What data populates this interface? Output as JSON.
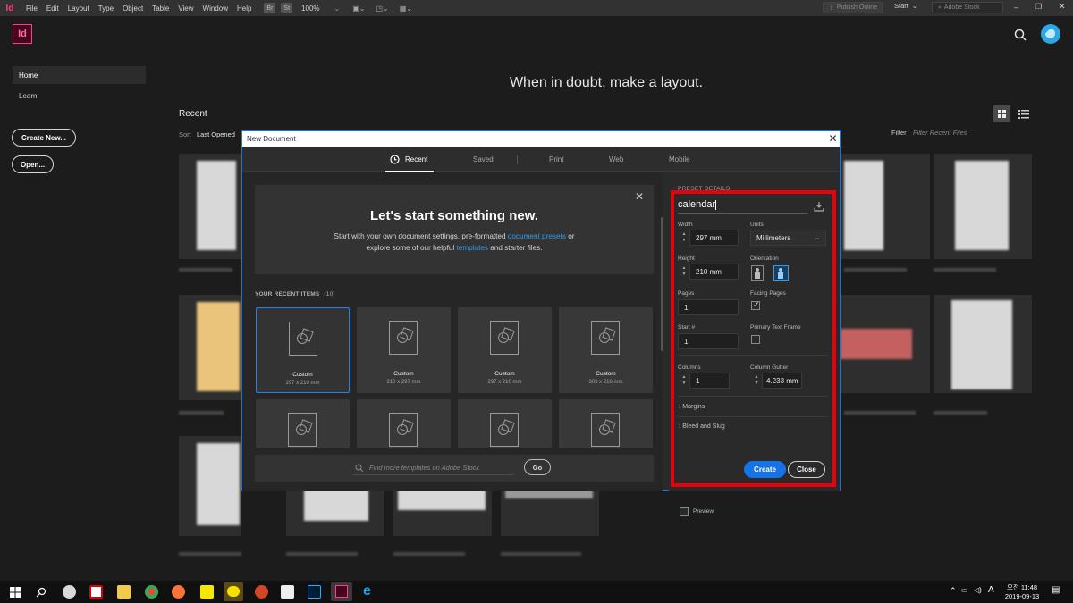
{
  "menubar": {
    "app_abbr": "Id",
    "items": [
      "File",
      "Edit",
      "Layout",
      "Type",
      "Object",
      "Table",
      "View",
      "Window",
      "Help"
    ],
    "bridge_chip": "Br",
    "stock_chip": "St",
    "zoom": "100%",
    "publish_online": "Publish Online",
    "workspace": "Start",
    "stock_search_placeholder": "Adobe Stock"
  },
  "home": {
    "app_logo": "Id",
    "nav": {
      "home": "Home",
      "learn": "Learn"
    },
    "create_new": "Create New...",
    "open": "Open...",
    "tagline": "When in doubt, make a layout.",
    "recent_heading": "Recent",
    "sort_label": "Sort",
    "sort_value": "Last Opened",
    "filter_label": "Filter",
    "filter_placeholder": "Filter Recent Files"
  },
  "dialog": {
    "title": "New Document",
    "close_glyph": "✕",
    "tabs": [
      "Recent",
      "Saved",
      "Print",
      "Web",
      "Mobile"
    ],
    "active_tab": "Recent",
    "hero": {
      "title": "Let's start something new.",
      "line1_pre": "Start with your own document settings, pre-formatted ",
      "line1_link": "document presets",
      "line1_post": " or",
      "line2_pre": "explore some of our helpful ",
      "line2_link": "templates",
      "line2_post": " and starter files.",
      "close_glyph": "✕"
    },
    "recent_label": "YOUR RECENT ITEMS",
    "recent_count": "(10)",
    "cards": [
      {
        "name": "Custom",
        "size": "297 x 210 mm",
        "selected": true
      },
      {
        "name": "Custom",
        "size": "210 x 297 mm",
        "selected": false
      },
      {
        "name": "Custom",
        "size": "297 x 210 mm",
        "selected": false
      },
      {
        "name": "Custom",
        "size": "303 x 216 mm",
        "selected": false
      }
    ],
    "stock_search_placeholder": "Find more templates on Adobe Stock",
    "go_button": "Go"
  },
  "preset": {
    "heading": "PRESET DETAILS",
    "name": "calendar",
    "width_label": "Width",
    "width_value": "297 mm",
    "units_label": "Units",
    "units_value": "Millimeters",
    "height_label": "Height",
    "height_value": "210 mm",
    "orientation_label": "Orientation",
    "orientation": "landscape",
    "pages_label": "Pages",
    "pages_value": "1",
    "facing_label": "Facing Pages",
    "facing_checked": true,
    "start_label": "Start #",
    "start_value": "1",
    "primary_label": "Primary Text Frame",
    "primary_checked": false,
    "columns_label": "Columns",
    "columns_value": "1",
    "gutter_label": "Column Gutter",
    "gutter_value": "4.233 mm",
    "margins_label": "Margins",
    "bleed_label": "Bleed and Slug",
    "preview_label": "Preview",
    "create_button": "Create",
    "close_button": "Close"
  },
  "taskbar": {
    "time": "오전 11:48",
    "date": "2019-09-13",
    "ime_indicator": "A"
  },
  "colors": {
    "accent_blue": "#1473e6",
    "highlight_red": "#e8000b",
    "indesign_pink": "#ff3d7f"
  }
}
